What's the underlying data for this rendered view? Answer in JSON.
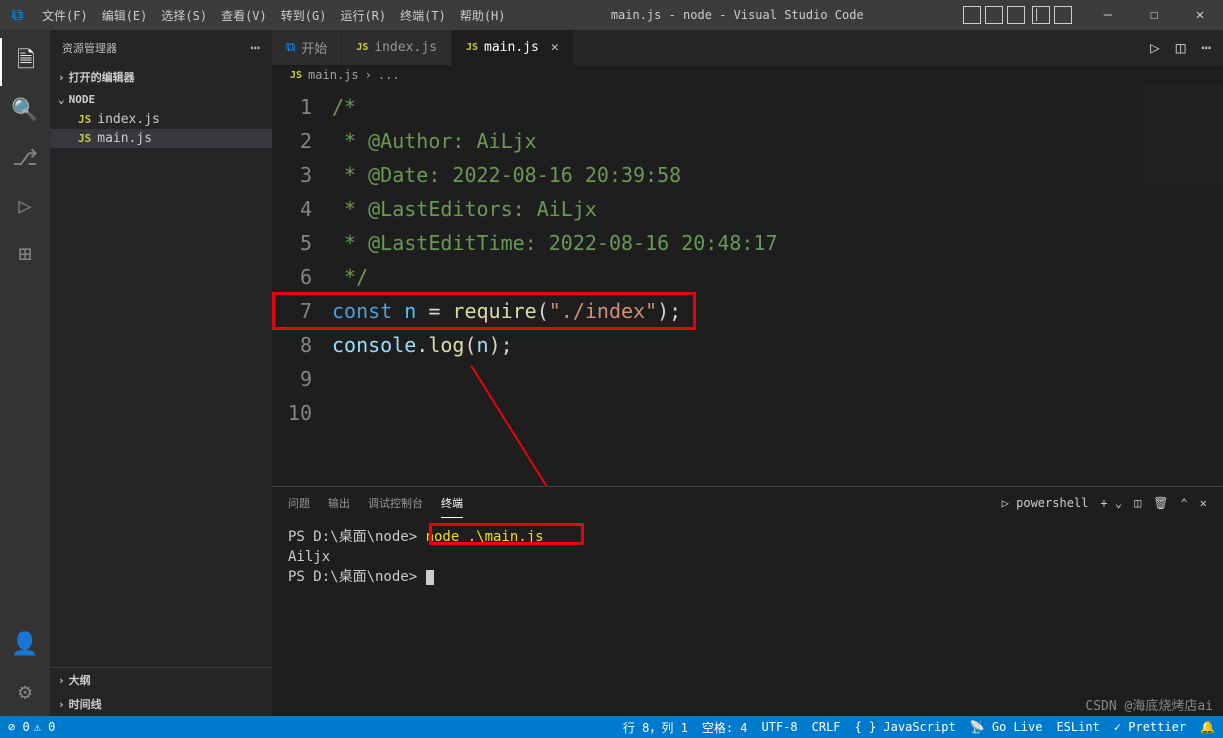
{
  "titlebar": {
    "menus": [
      "文件(F)",
      "编辑(E)",
      "选择(S)",
      "查看(V)",
      "转到(G)",
      "运行(R)",
      "终端(T)",
      "帮助(H)"
    ],
    "title": "main.js - node - Visual Studio Code"
  },
  "sidebar": {
    "header": "资源管理器",
    "openEditors": "打开的编辑器",
    "project": "NODE",
    "files": [
      "index.js",
      "main.js"
    ],
    "outline": "大纲",
    "timeline": "时间线"
  },
  "tabs": {
    "welcome": "开始",
    "file1": "index.js",
    "file2": "main.js"
  },
  "breadcrumb": {
    "file": "main.js",
    "rest": "..."
  },
  "code": {
    "l1": "/*",
    "l2": " * @Author: AiLjx",
    "l3": " * @Date: 2022-08-16 20:39:58",
    "l4": " * @LastEditors: AiLjx",
    "l5": " * @LastEditTime: 2022-08-16 20:48:17",
    "l6": " */",
    "l7_const": "const ",
    "l7_n": "n",
    "l7_eq": " = ",
    "l7_req": "require",
    "l7_p1": "(",
    "l7_str": "\"./index\"",
    "l7_p2": ");",
    "l9_console": "console",
    "l9_dot": ".",
    "l9_log": "log",
    "l9_p1": "(",
    "l9_n": "n",
    "l9_p2": ");"
  },
  "panel": {
    "tabs": [
      "问题",
      "输出",
      "调试控制台",
      "终端"
    ],
    "shell": "powershell"
  },
  "terminal": {
    "l1_prompt": "PS D:\\桌面\\node> ",
    "l1_cmd": "node .\\main.js",
    "l2": "Ailjx",
    "l3_prompt": "PS D:\\桌面\\node> "
  },
  "statusbar": {
    "errors": "0",
    "warnings": "0",
    "pos": "行 8，列 1",
    "spaces": "空格: 4",
    "encoding": "UTF-8",
    "eol": "CRLF",
    "lang": "{ } JavaScript",
    "golive": "Go Live",
    "eslint": "ESLint",
    "prettier": "Prettier",
    "bell": "🔔"
  },
  "watermark": "CSDN @海底烧烤店ai"
}
